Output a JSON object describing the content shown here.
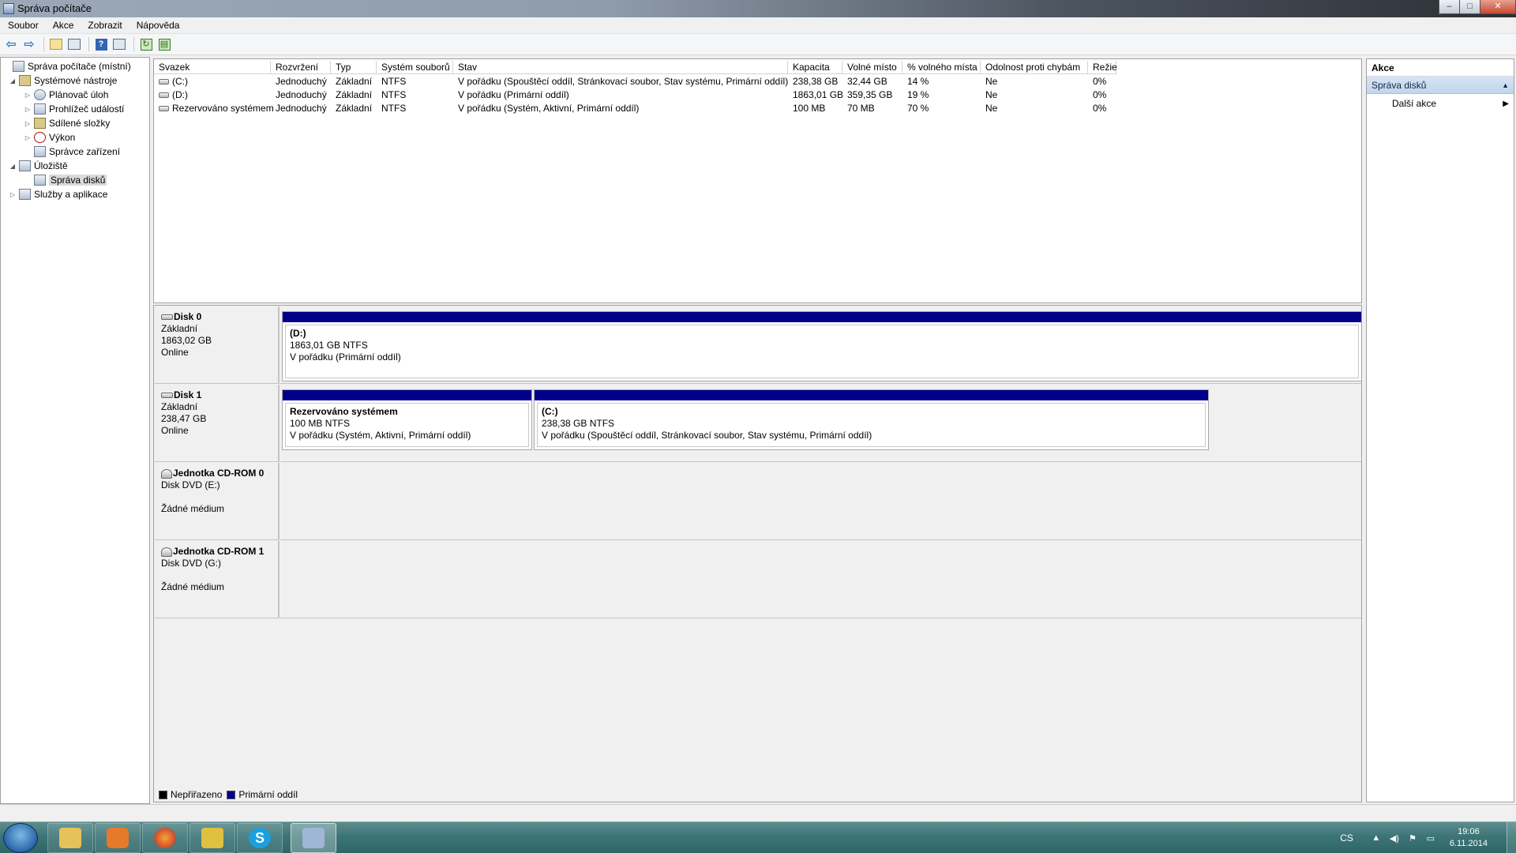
{
  "window": {
    "title": "Správa počítače"
  },
  "menu": [
    "Soubor",
    "Akce",
    "Zobrazit",
    "Nápověda"
  ],
  "tree": [
    {
      "label": "Správa počítače (místní)",
      "level": 0,
      "expander": "",
      "icon": "computer-icon"
    },
    {
      "label": "Systémové nástroje",
      "level": 1,
      "expander": "◢",
      "icon": "tools-icon"
    },
    {
      "label": "Plánovač úloh",
      "level": 2,
      "expander": "▷",
      "icon": "clock-icon"
    },
    {
      "label": "Prohlížeč událostí",
      "level": 2,
      "expander": "▷",
      "icon": "event-viewer-icon"
    },
    {
      "label": "Sdílené složky",
      "level": 2,
      "expander": "▷",
      "icon": "shared-folder-icon"
    },
    {
      "label": "Výkon",
      "level": 2,
      "expander": "▷",
      "icon": "performance-icon"
    },
    {
      "label": "Správce zařízení",
      "level": 2,
      "expander": "",
      "icon": "device-manager-icon"
    },
    {
      "label": "Úložiště",
      "level": 1,
      "expander": "◢",
      "icon": "storage-icon"
    },
    {
      "label": "Správa disků",
      "level": 2,
      "expander": "",
      "icon": "disk-management-icon",
      "selected": true
    },
    {
      "label": "Služby a aplikace",
      "level": 1,
      "expander": "▷",
      "icon": "services-icon"
    }
  ],
  "volumes": {
    "headers": [
      "Svazek",
      "Rozvržení",
      "Typ",
      "Systém souborů",
      "Stav",
      "Kapacita",
      "Volné místo",
      "% volného místa",
      "Odolnost proti chybám",
      "Režie"
    ],
    "rows": [
      [
        "(C:)",
        "Jednoduchý",
        "Základní",
        "NTFS",
        "V pořádku (Spouštěcí oddíl, Stránkovací soubor, Stav systému, Primární oddíl)",
        "238,38 GB",
        "32,44 GB",
        "14 %",
        "Ne",
        "0%"
      ],
      [
        "(D:)",
        "Jednoduchý",
        "Základní",
        "NTFS",
        "V pořádku (Primární oddíl)",
        "1863,01 GB",
        "359,35 GB",
        "19 %",
        "Ne",
        "0%"
      ],
      [
        "Rezervováno systémem",
        "Jednoduchý",
        "Základní",
        "NTFS",
        "V pořádku (Systém, Aktivní, Primární oddíl)",
        "100 MB",
        "70 MB",
        "70 %",
        "Ne",
        "0%"
      ]
    ]
  },
  "disks": [
    {
      "name": "Disk 0",
      "kind": "hdd",
      "type": "Základní",
      "size": "1863,02 GB",
      "status": "Online",
      "partitions": [
        {
          "name": "(D:)",
          "size_fs": "1863,01 GB NTFS",
          "status": "V pořádku (Primární oddíl)"
        }
      ]
    },
    {
      "name": "Disk 1",
      "kind": "hdd",
      "type": "Základní",
      "size": "238,47 GB",
      "status": "Online",
      "partitions": [
        {
          "name": "Rezervováno systémem",
          "size_fs": "100 MB NTFS",
          "status": "V pořádku (Systém, Aktivní, Primární oddíl)"
        },
        {
          "name": "(C:)",
          "size_fs": "238,38 GB NTFS",
          "status": "V pořádku (Spouštěcí oddíl, Stránkovací soubor, Stav systému, Primární oddíl)"
        }
      ]
    },
    {
      "name": "Jednotka CD-ROM 0",
      "kind": "cd",
      "type": "Disk DVD (E:)",
      "size": "",
      "status": "Žádné médium",
      "partitions": []
    },
    {
      "name": "Jednotka CD-ROM 1",
      "kind": "cd",
      "type": "Disk DVD (G:)",
      "size": "",
      "status": "Žádné médium",
      "partitions": []
    }
  ],
  "legend": [
    {
      "label": "Nepřiřazeno",
      "color": "#000000"
    },
    {
      "label": "Primární oddíl",
      "color": "#00008b"
    }
  ],
  "actions": {
    "title": "Akce",
    "section": "Správa disků",
    "items": [
      "Další akce"
    ]
  },
  "taskbar": {
    "apps": [
      {
        "name": "explorer",
        "color": "#e6c25a"
      },
      {
        "name": "media-player",
        "color": "#e57a2a"
      },
      {
        "name": "firefox",
        "color": "#d9552a"
      },
      {
        "name": "utility",
        "color": "#e0c040"
      },
      {
        "name": "skype",
        "color": "#1aa0e0"
      },
      {
        "name": "computer-management",
        "color": "#9fb6d6"
      }
    ],
    "language": "CS",
    "time": "19:06",
    "date": "6.11.2014"
  }
}
